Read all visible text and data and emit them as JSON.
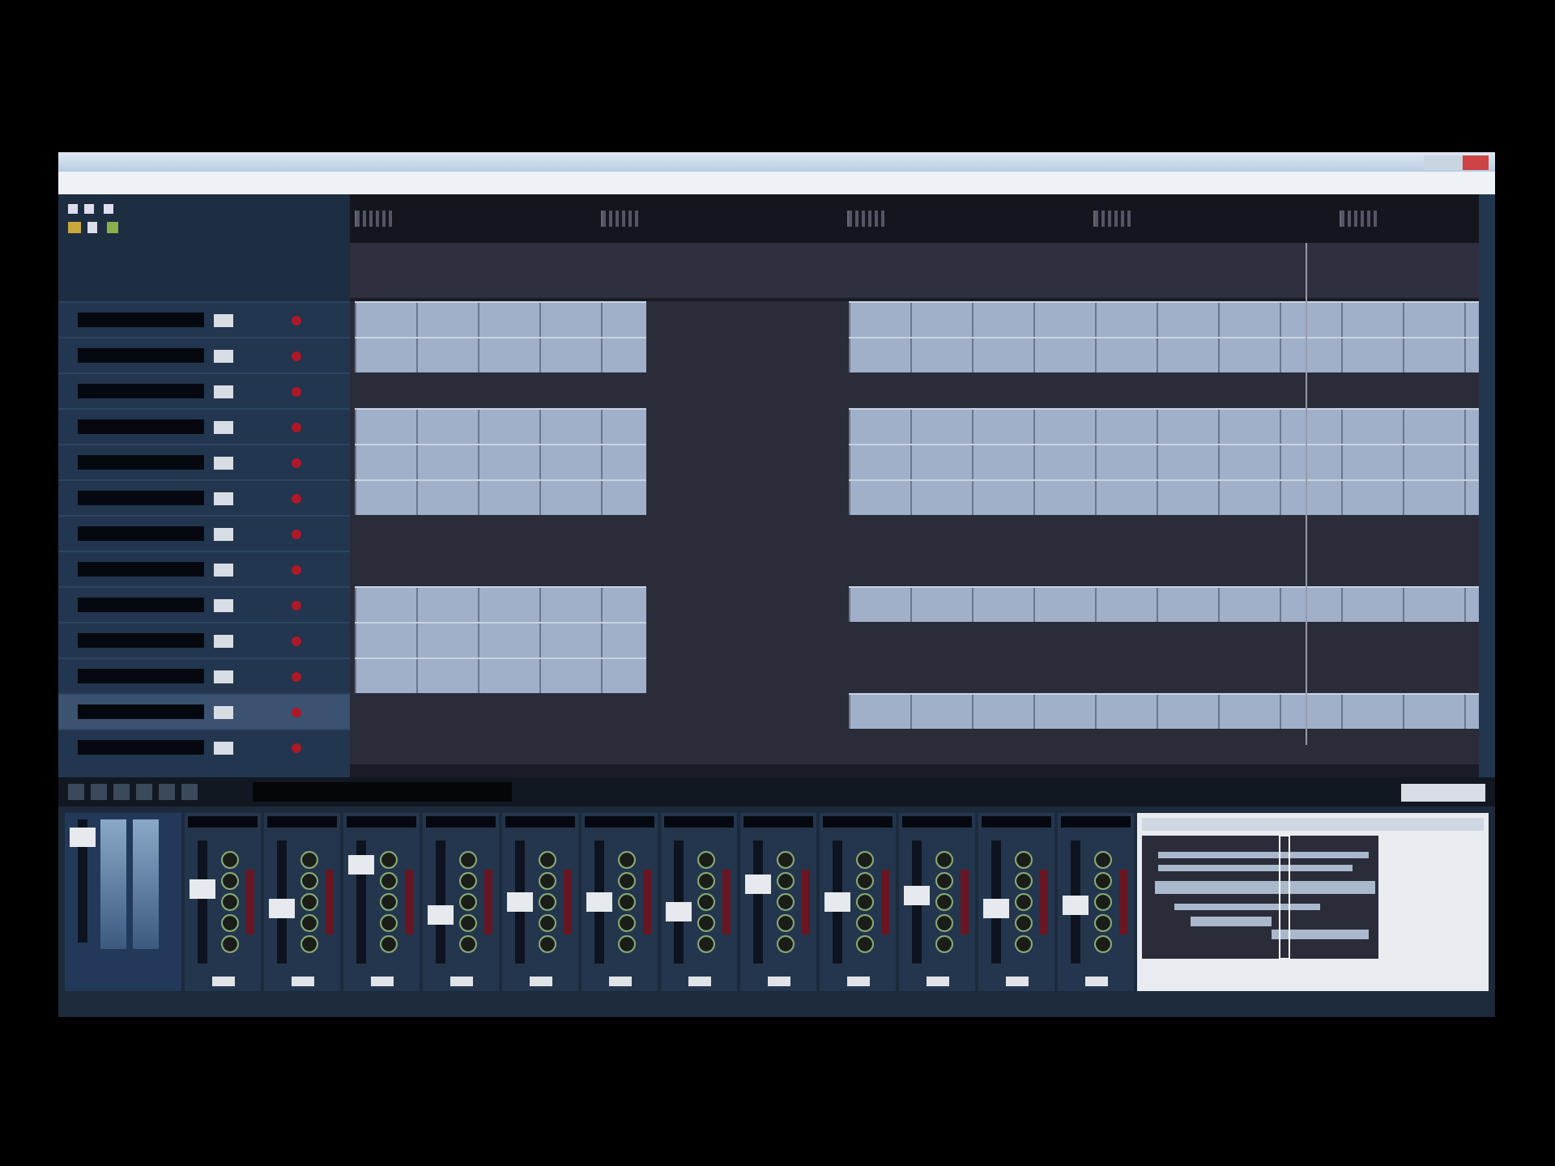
{
  "tracks": [
    {
      "selected": false,
      "parts": [
        {
          "kind": "left"
        },
        {
          "kind": "right"
        }
      ]
    },
    {
      "selected": false,
      "parts": [
        {
          "kind": "left"
        },
        {
          "kind": "right"
        }
      ]
    },
    {
      "selected": false
    },
    {
      "selected": false,
      "parts": [
        {
          "kind": "left"
        },
        {
          "kind": "right"
        }
      ]
    },
    {
      "selected": false,
      "parts": [
        {
          "kind": "left"
        },
        {
          "kind": "right"
        }
      ]
    },
    {
      "selected": false,
      "parts": [
        {
          "kind": "left"
        },
        {
          "kind": "right"
        }
      ]
    },
    {
      "selected": false
    },
    {
      "selected": false
    },
    {
      "selected": false,
      "parts": [
        {
          "kind": "left"
        },
        {
          "kind": "right"
        }
      ]
    },
    {
      "selected": false,
      "parts": [
        {
          "kind": "left"
        }
      ]
    },
    {
      "selected": false,
      "parts": [
        {
          "kind": "left"
        }
      ]
    },
    {
      "selected": true,
      "parts": [
        {
          "kind": "right"
        }
      ]
    },
    {
      "selected": false
    }
  ],
  "mixer": {
    "master": {
      "level": 0.85
    },
    "channels": [
      {
        "level": 0.6
      },
      {
        "level": 0.45
      },
      {
        "level": 0.8
      },
      {
        "level": 0.4
      },
      {
        "level": 0.5
      },
      {
        "level": 0.5
      },
      {
        "level": 0.42
      },
      {
        "level": 0.65
      },
      {
        "level": 0.5
      },
      {
        "level": 0.55
      },
      {
        "level": 0.45
      },
      {
        "level": 0.48
      }
    ]
  }
}
